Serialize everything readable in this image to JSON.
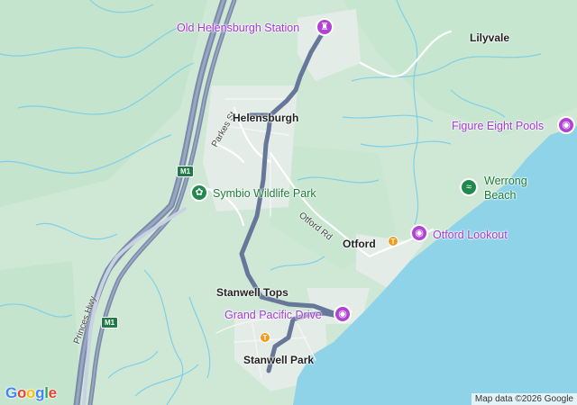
{
  "map": {
    "labels": {
      "old_helensburgh_station": "Old Helensburgh Station",
      "lilyvale": "Lilyvale",
      "helensburgh": "Helensburgh",
      "parkes_st": "Parkes St",
      "figure_eight_pools": "Figure Eight Pools",
      "symbio_wildlife_park": "Symbio Wildlife Park",
      "werrong_beach_line1": "Werrong",
      "werrong_beach_line2": "Beach",
      "otford_rd": "Otford Rd",
      "otford": "Otford",
      "otford_lookout": "Otford Lookout",
      "stanwell_tops": "Stanwell Tops",
      "grand_pacific_drive": "Grand Pacific Drive",
      "stanwell_park": "Stanwell Park",
      "princes_hwy": "Princes Hwy"
    },
    "road_shields": {
      "m1_north": "M1",
      "m1_south": "M1"
    },
    "attribution": "Map data ©2026 Google",
    "logo": "Google",
    "colors": {
      "land": "#cfe8d6",
      "forest": "#bfe2c9",
      "water": "#8fd3e8",
      "route": "#67779a",
      "poi": "#a23ad6",
      "park": "#1f8a4c",
      "stream": "#7fd0e6"
    },
    "icons": [
      "castle-icon",
      "camera-icon",
      "paw-icon",
      "swim-icon",
      "food-icon",
      "attraction-icon"
    ]
  }
}
